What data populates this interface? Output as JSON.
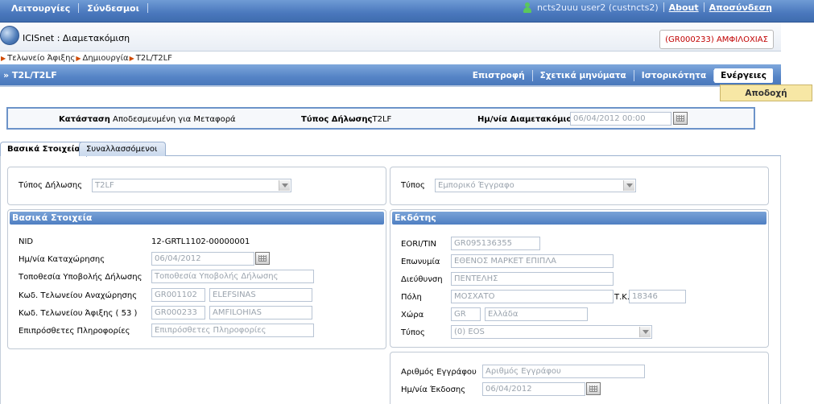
{
  "topbar": {
    "menu": [
      "Λειτουργίες",
      "Σύνδεσμοι"
    ],
    "user": "ncts2uuu user2 (custncts2)",
    "about": "About",
    "logout": "Αποσύνδεση"
  },
  "app": {
    "title": "ICISnet : Διαμετακόμιση",
    "office": "(GR000233) ΑΜΦΙΛΟΧΙΑΣ"
  },
  "breadcrumb": [
    "Τελωνείο Άφιξης",
    "Δημιουργία",
    "T2L/T2LF"
  ],
  "titlebar": {
    "title": "» T2L/T2LF",
    "actions": [
      "Επιστροφή",
      "Σχετικά μηνύματα",
      "Ιστορικότητα",
      "Ενέργειες"
    ],
    "dropdown_item": "Αποδοχή"
  },
  "status": {
    "state_label": "Κατάσταση",
    "state_value": "Αποδεσμευμένη για Μεταφορά",
    "type_label": "Τύπος Δήλωσης",
    "type_value": "T2LF",
    "date_label": "Ημ/νία Διαμετακόμισης",
    "date_value": "06/04/2012 00:00"
  },
  "tabs": [
    "Βασικά Στοιχεία",
    "Συναλλασσόμενοι"
  ],
  "left": {
    "decl_type_label": "Τύπος Δήλωσης",
    "decl_type_value": "T2LF",
    "section_title": "Βασικά Στοιχεία",
    "nid_label": "NID",
    "nid_value": "12-GRTL1102-00000001",
    "reg_date_label": "Ημ/νία Καταχώρησης",
    "reg_date_value": "06/04/2012",
    "location_label": "Τοποθεσία Υποβολής Δήλωσης",
    "location_placeholder": "Τοποθεσία Υποβολής Δήλωσης",
    "dep_office_label": "Κωδ. Τελωνείου Αναχώρησης",
    "dep_office_code": "GR001102",
    "dep_office_name": "ELEFSINAS",
    "arr_office_label": "Κωδ. Τελωνείου Άφιξης ( 53 )",
    "arr_office_code": "GR000233",
    "arr_office_name": "AMFILOHIAS",
    "extra_label": "Επιπρόσθετες Πληροφορίες",
    "extra_placeholder": "Επιπρόσθετες Πληροφορίες"
  },
  "right": {
    "type_label": "Τύπος",
    "type_value": "Εμπορικό Έγγραφο",
    "section_title": "Εκδότης",
    "eori_label": "EORI/TIN",
    "eori_value": "GR095136355",
    "name_label": "Επωνυμία",
    "name_value": "ΕΘΕΝΟΣ ΜΑΡΚΕΤ ΕΠΙΠΛΑ",
    "address_label": "Διεύθυνση",
    "address_value": "ΠΕΝΤΕΛΗΣ",
    "city_label": "Πόλη",
    "city_value": "ΜΟΣΧΑΤΟ",
    "zip_label": "Τ.Κ.",
    "zip_value": "18346",
    "country_label": "Χώρα",
    "country_code": "GR",
    "country_name": "Ελλάδα",
    "kind_label": "Τύπος",
    "kind_value": "(0) EOS",
    "doc_no_label": "Αριθμός Εγγράφου",
    "doc_no_placeholder": "Αριθμός Εγγράφου",
    "issue_date_label": "Ημ/νία Έκδοσης",
    "issue_date_value": "06/04/2012"
  }
}
